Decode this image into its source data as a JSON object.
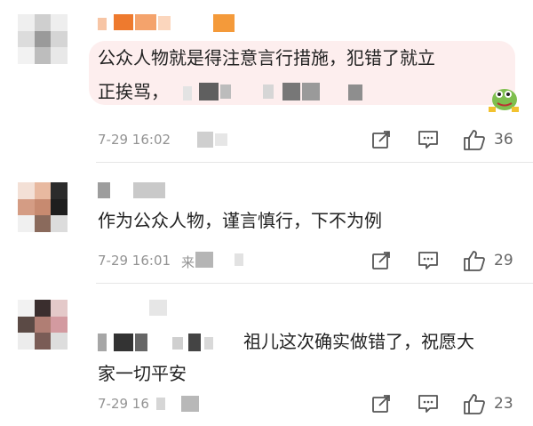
{
  "comments": [
    {
      "text_line1": "公众人物就是得注意言行措施，犯错了就立",
      "text_line2": "正挨骂，",
      "time": "7-29 16:02",
      "likes": "36"
    },
    {
      "text_line1": "作为公众人物，谨言慎行，下不为例",
      "time": "7-29 16:01",
      "time_suffix": "来",
      "likes": "29"
    },
    {
      "text_line1": "祖儿这次确实做错了，祝愿大",
      "text_line2": "家一切平安",
      "time": "7-29 16",
      "likes": "23"
    }
  ],
  "icons": {
    "repost": "share-icon",
    "comment": "comment-icon",
    "like": "thumbs-up-icon",
    "sticker": "frog-sticker-icon"
  },
  "colors": {
    "highlight_bg": "#fdeeee",
    "meta_text": "#939393",
    "icon_stroke": "#555555",
    "divider": "#e6e6e6"
  }
}
